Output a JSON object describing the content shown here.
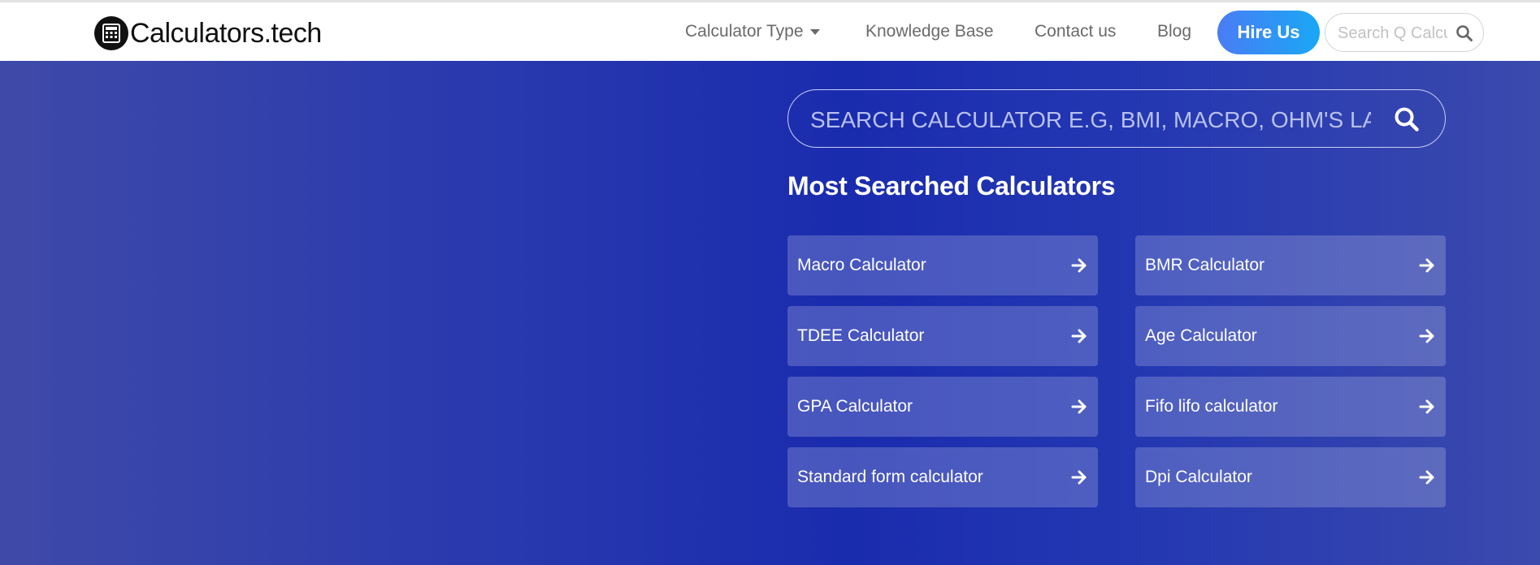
{
  "header": {
    "brand": "Calculators.tech",
    "nav": [
      {
        "label": "Calculator Type",
        "has_caret": true
      },
      {
        "label": "Knowledge Base"
      },
      {
        "label": "Contact us"
      },
      {
        "label": "Blog"
      }
    ],
    "hire_label": "Hire Us",
    "search_placeholder": "Search Q Calculator",
    "icons": {
      "logo": "calculator-icon",
      "search": "search-icon",
      "caret": "caret-down-icon"
    }
  },
  "hero": {
    "search_placeholder": "SEARCH CALCULATOR E.G, BMI, MACRO, OHM'S LAW",
    "section_title": "Most Searched Calculators",
    "calculators": [
      {
        "label": "Macro Calculator"
      },
      {
        "label": "BMR Calculator"
      },
      {
        "label": "TDEE Calculator"
      },
      {
        "label": "Age Calculator"
      },
      {
        "label": "GPA Calculator"
      },
      {
        "label": "Fifo lifo calculator"
      },
      {
        "label": "Standard form calculator"
      },
      {
        "label": "Dpi Calculator"
      }
    ],
    "card_icon": "arrow-right-icon"
  },
  "colors": {
    "hero_blue": "#1a2cae",
    "hire_gradient_start": "#4a7cf5",
    "hire_gradient_end": "#19a8f5",
    "nav_text": "#6a6a6a"
  }
}
